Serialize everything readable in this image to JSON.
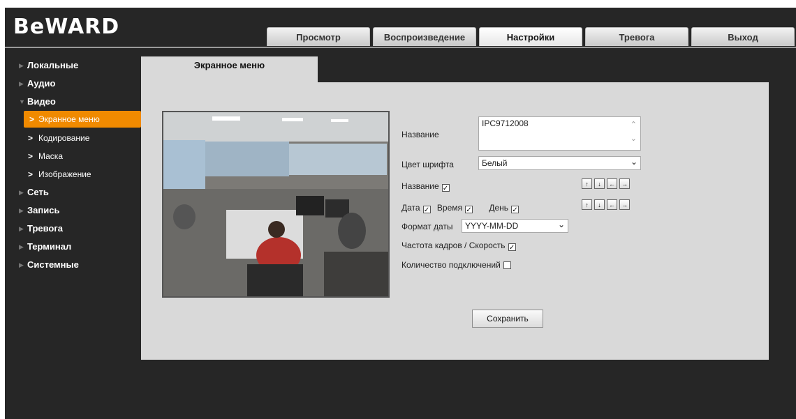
{
  "brand": "BeWARD",
  "nav_tabs": [
    "Просмотр",
    "Воспроизведение",
    "Настройки",
    "Тревога",
    "Выход"
  ],
  "sidebar": {
    "items": [
      {
        "label": "Локальные"
      },
      {
        "label": "Аудио"
      },
      {
        "label": "Видео"
      },
      {
        "label": "Экранное меню"
      },
      {
        "label": "Кодирование"
      },
      {
        "label": "Маска"
      },
      {
        "label": "Изображение"
      },
      {
        "label": "Сеть"
      },
      {
        "label": "Запись"
      },
      {
        "label": "Тревога"
      },
      {
        "label": "Терминал"
      },
      {
        "label": "Системные"
      }
    ]
  },
  "content": {
    "tab_title": "Экранное меню",
    "name_label": "Название",
    "name_value": "IPC9712008",
    "font_color_label": "Цвет шрифта",
    "font_color_value": "Белый",
    "name_show_label": "Название",
    "date_label": "Дата",
    "time_label": "Время",
    "day_label": "День",
    "date_format_label": "Формат даты",
    "date_format_value": "YYYY-MM-DD",
    "fps_label": "Частота кадров / Скорость",
    "connections_label": "Количество подключений",
    "save_label": "Сохранить"
  },
  "colors": {
    "accent": "#f08a00",
    "background": "#262626",
    "panel": "#d9d9d9"
  },
  "icons": [
    "sidebar-triangle-icon",
    "chevron-right-icon",
    "arrow-up-icon",
    "arrow-down-icon",
    "arrow-left-icon",
    "arrow-right-icon",
    "chevron-down-icon"
  ]
}
